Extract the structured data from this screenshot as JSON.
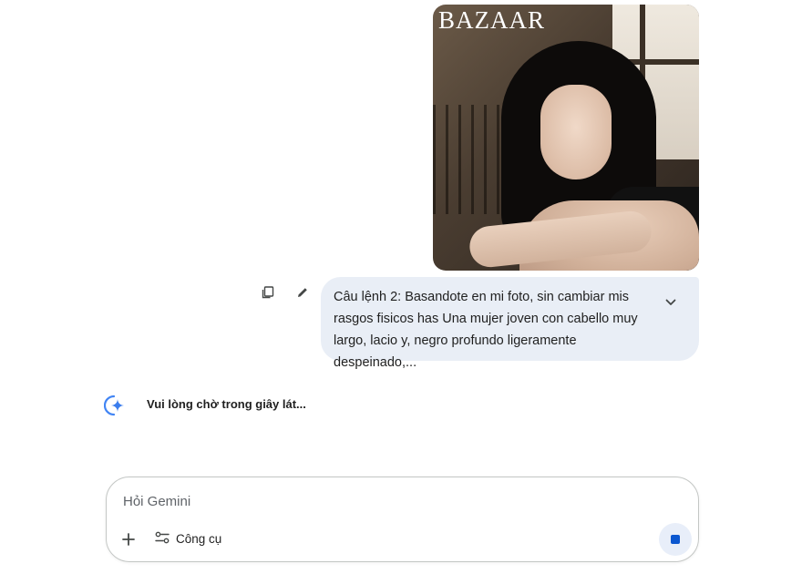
{
  "conversation": {
    "image": {
      "logo_text": "BAZAAR"
    },
    "user_message": {
      "text": "Câu lệnh 2: Basandote en mi foto, sin cambiar mis rasgos fisicos has Una mujer joven con cabello muy largo, lacio y, negro profundo ligeramente despeinado,...",
      "icons": {
        "copy": "copy-icon",
        "edit": "pencil-icon",
        "expand": "chevron-down-icon"
      }
    },
    "response": {
      "status": "Vui lòng chờ trong giây lát...",
      "avatar_icon": "gemini-sparkle-icon"
    }
  },
  "composer": {
    "placeholder": "Hỏi Gemini",
    "tools_label": "Công cụ",
    "icons": {
      "add": "plus-icon",
      "tools": "tools-sliders-icon",
      "stop": "stop-icon"
    }
  },
  "colors": {
    "bubble_bg": "#e9eef6",
    "accent_blue": "#0b57d0",
    "stop_bg": "#e8eef9"
  }
}
